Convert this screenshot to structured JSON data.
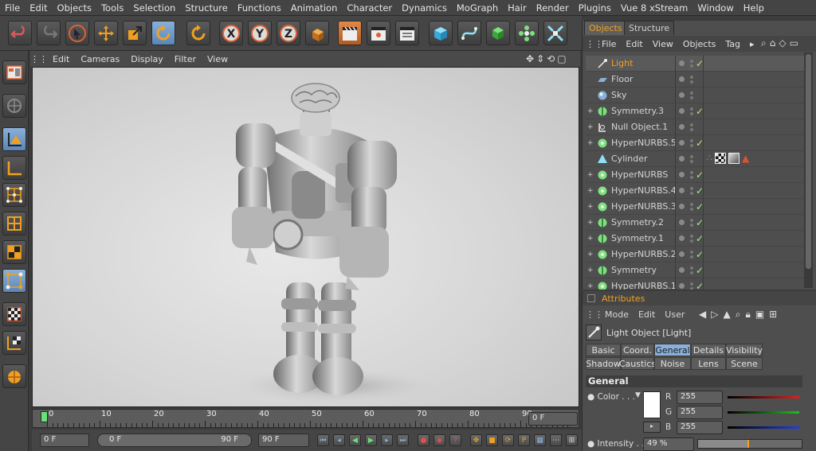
{
  "menu": [
    "File",
    "Edit",
    "Objects",
    "Tools",
    "Selection",
    "Structure",
    "Functions",
    "Animation",
    "Character",
    "Dynamics",
    "MoGraph",
    "Hair",
    "Render",
    "Plugins",
    "Vue 8 xStream",
    "Window",
    "Help"
  ],
  "toolbar_icons": [
    "undo-icon",
    "redo-icon",
    "select-icon",
    "move-icon",
    "scale-icon",
    "rotate-icon",
    "rotate-alt-icon",
    "x-axis-icon",
    "y-axis-icon",
    "z-axis-icon",
    "coordinate-system-icon",
    "render-view-icon",
    "render-picture-queue-icon",
    "render-settings-icon",
    "cube-icon",
    "spline-icon",
    "nurbs-icon",
    "array-icon",
    "deformer-icon"
  ],
  "toolbar_axis": {
    "x": "X",
    "y": "Y",
    "z": "Z"
  },
  "left_tools": [
    "layout-icon",
    "object-mode-icon",
    "model-mode-icon",
    "object-axis-icon",
    "points-mode-icon",
    "edges-mode-icon",
    "polygons-mode-icon",
    "uvw-mode-icon",
    "texture-mode-icon",
    "texture-axis-icon",
    "sculpt-icon"
  ],
  "viewport_menu": [
    "Edit",
    "Cameras",
    "Display",
    "Filter",
    "View"
  ],
  "timeline": {
    "ticks": [
      "0",
      "10",
      "20",
      "30",
      "40",
      "50",
      "60",
      "70",
      "80",
      "90"
    ],
    "current_frame": "0 F",
    "start_field": "0 F",
    "range_start": "0 F",
    "range_end": "90 F",
    "end_field": "90 F"
  },
  "objects_panel": {
    "tabs": [
      "Objects",
      "Structure"
    ],
    "menu": [
      "File",
      "Edit",
      "View",
      "Objects",
      "Tag"
    ],
    "items": [
      {
        "name": "Light",
        "icon": "light-icon",
        "expand": "",
        "check": true,
        "color": "#f0a020"
      },
      {
        "name": "Floor",
        "icon": "floor-icon",
        "expand": "",
        "check": false,
        "color": ""
      },
      {
        "name": "Sky",
        "icon": "sky-icon",
        "expand": "",
        "check": false,
        "color": ""
      },
      {
        "name": "Symmetry.3",
        "icon": "symmetry-icon",
        "expand": "+",
        "check": true,
        "color": ""
      },
      {
        "name": "Null Object.1",
        "icon": "null-object-icon",
        "expand": "+",
        "check": false,
        "color": ""
      },
      {
        "name": "HyperNURBS.5",
        "icon": "hypernurbs-icon",
        "expand": "+",
        "check": true,
        "color": ""
      },
      {
        "name": "Cylinder",
        "icon": "cylinder-icon",
        "expand": "",
        "check": false,
        "color": ""
      },
      {
        "name": "HyperNURBS",
        "icon": "hypernurbs-icon",
        "expand": "+",
        "check": true,
        "color": ""
      },
      {
        "name": "HyperNURBS.4",
        "icon": "hypernurbs-icon",
        "expand": "+",
        "check": true,
        "color": ""
      },
      {
        "name": "HyperNURBS.3",
        "icon": "hypernurbs-icon",
        "expand": "+",
        "check": true,
        "color": ""
      },
      {
        "name": "Symmetry.2",
        "icon": "symmetry-icon",
        "expand": "+",
        "check": true,
        "color": ""
      },
      {
        "name": "Symmetry.1",
        "icon": "symmetry-icon",
        "expand": "+",
        "check": true,
        "color": ""
      },
      {
        "name": "HyperNURBS.2",
        "icon": "hypernurbs-icon",
        "expand": "+",
        "check": true,
        "color": ""
      },
      {
        "name": "Symmetry",
        "icon": "symmetry-icon",
        "expand": "+",
        "check": true,
        "color": ""
      },
      {
        "name": "HyperNURBS.1",
        "icon": "hypernurbs-icon",
        "expand": "+",
        "check": true,
        "color": ""
      }
    ]
  },
  "attributes": {
    "title": "Attributes",
    "menu": [
      "Mode",
      "Edit",
      "User"
    ],
    "object_title": "Light Object [Light]",
    "tabs_row1": [
      "Basic",
      "Coord.",
      "General",
      "Details",
      "Visibility"
    ],
    "tabs_row2": [
      "Shadow",
      "Caustics",
      "Noise",
      "Lens",
      "Scene"
    ],
    "active_tab": "General",
    "section": "General",
    "color_label": "Color . . .",
    "r_label": "R",
    "r_value": "255",
    "g_label": "G",
    "g_value": "255",
    "b_label": "B",
    "b_value": "255",
    "intensity_label": "Intensity . . .",
    "intensity_value": "49 %",
    "intensity_level": 0.49
  },
  "colors": {
    "accent": "#f0a020",
    "selected_tab": "#8ab0d8",
    "check": "#a6f07a"
  }
}
